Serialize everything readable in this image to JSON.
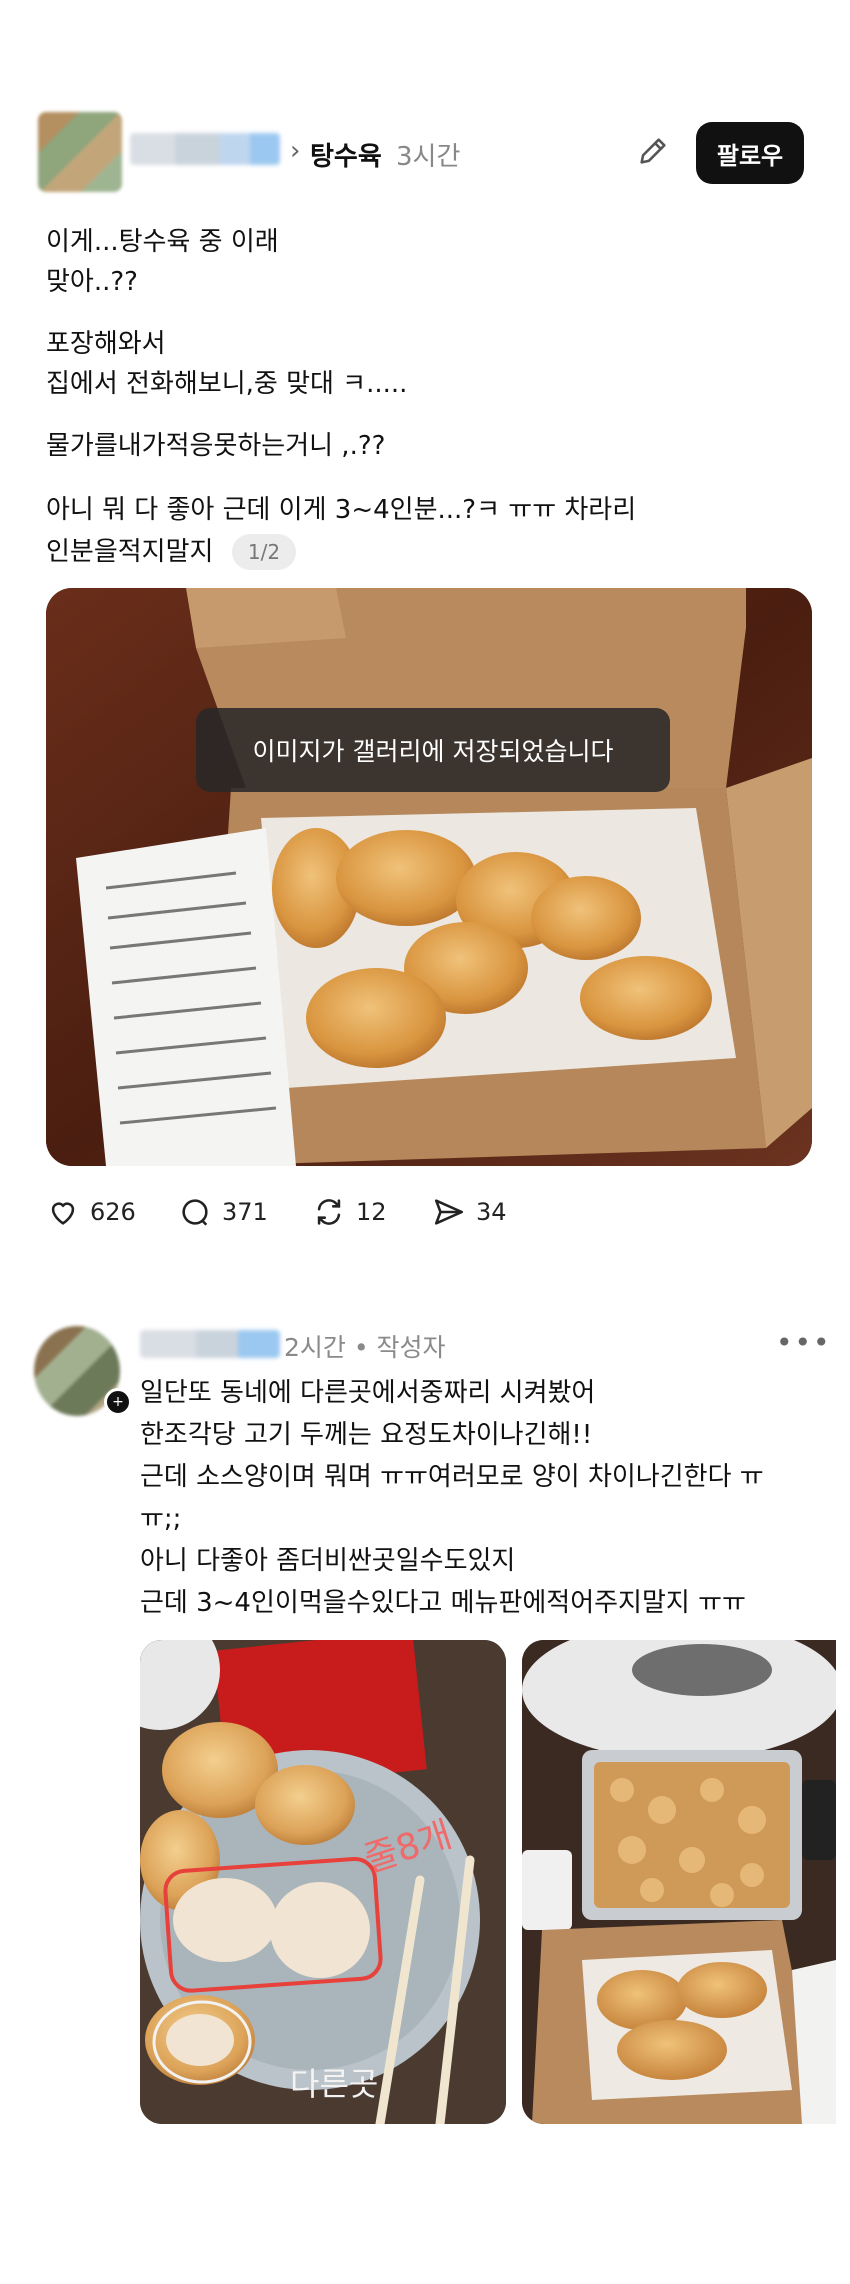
{
  "post": {
    "topic_chevron": "›",
    "topic": "탕수육",
    "time": "3시간",
    "follow_label": "팔로우",
    "lines": [
      "이게...탕수육 중 이래",
      "맞아..??",
      "포장해와서",
      "집에서 전화해보니,중 맞대 ㅋ.....",
      "물가를내가적응못하는거니 ,.??",
      "아니 뭐 다 좋아 근데 이게 3~4인분...?ㅋ ㅠㅠ 차라리",
      "인분을적지말지"
    ],
    "pager": "1/2",
    "toast": "이미지가 갤러리에 저장되었습니다",
    "stats": {
      "likes": "626",
      "comments": "371",
      "reposts": "12",
      "shares": "34"
    }
  },
  "reply": {
    "meta": "2시간 • 작성자",
    "more": "•••",
    "lines": [
      "일단또 동네에 다른곳에서중짜리 시켜봤어",
      "한조각당 고기 두께는 요정도차이나긴해!!",
      "근데 소스양이며 뭐며 ㅠㅠ여러모로 양이 차이나긴한다 ㅠ",
      "ㅠ;;",
      "아니 다좋아 좀더비싼곳일수도있지",
      "근데 3~4인이먹을수있다고 메뉴판에적어주지말지 ㅠㅠ"
    ],
    "handwriting": [
      "줄8개",
      "다른곳"
    ]
  },
  "colors": {
    "follow_bg": "#111111",
    "toast_bg": "#282828",
    "meta_gray": "#8a8a8a"
  }
}
